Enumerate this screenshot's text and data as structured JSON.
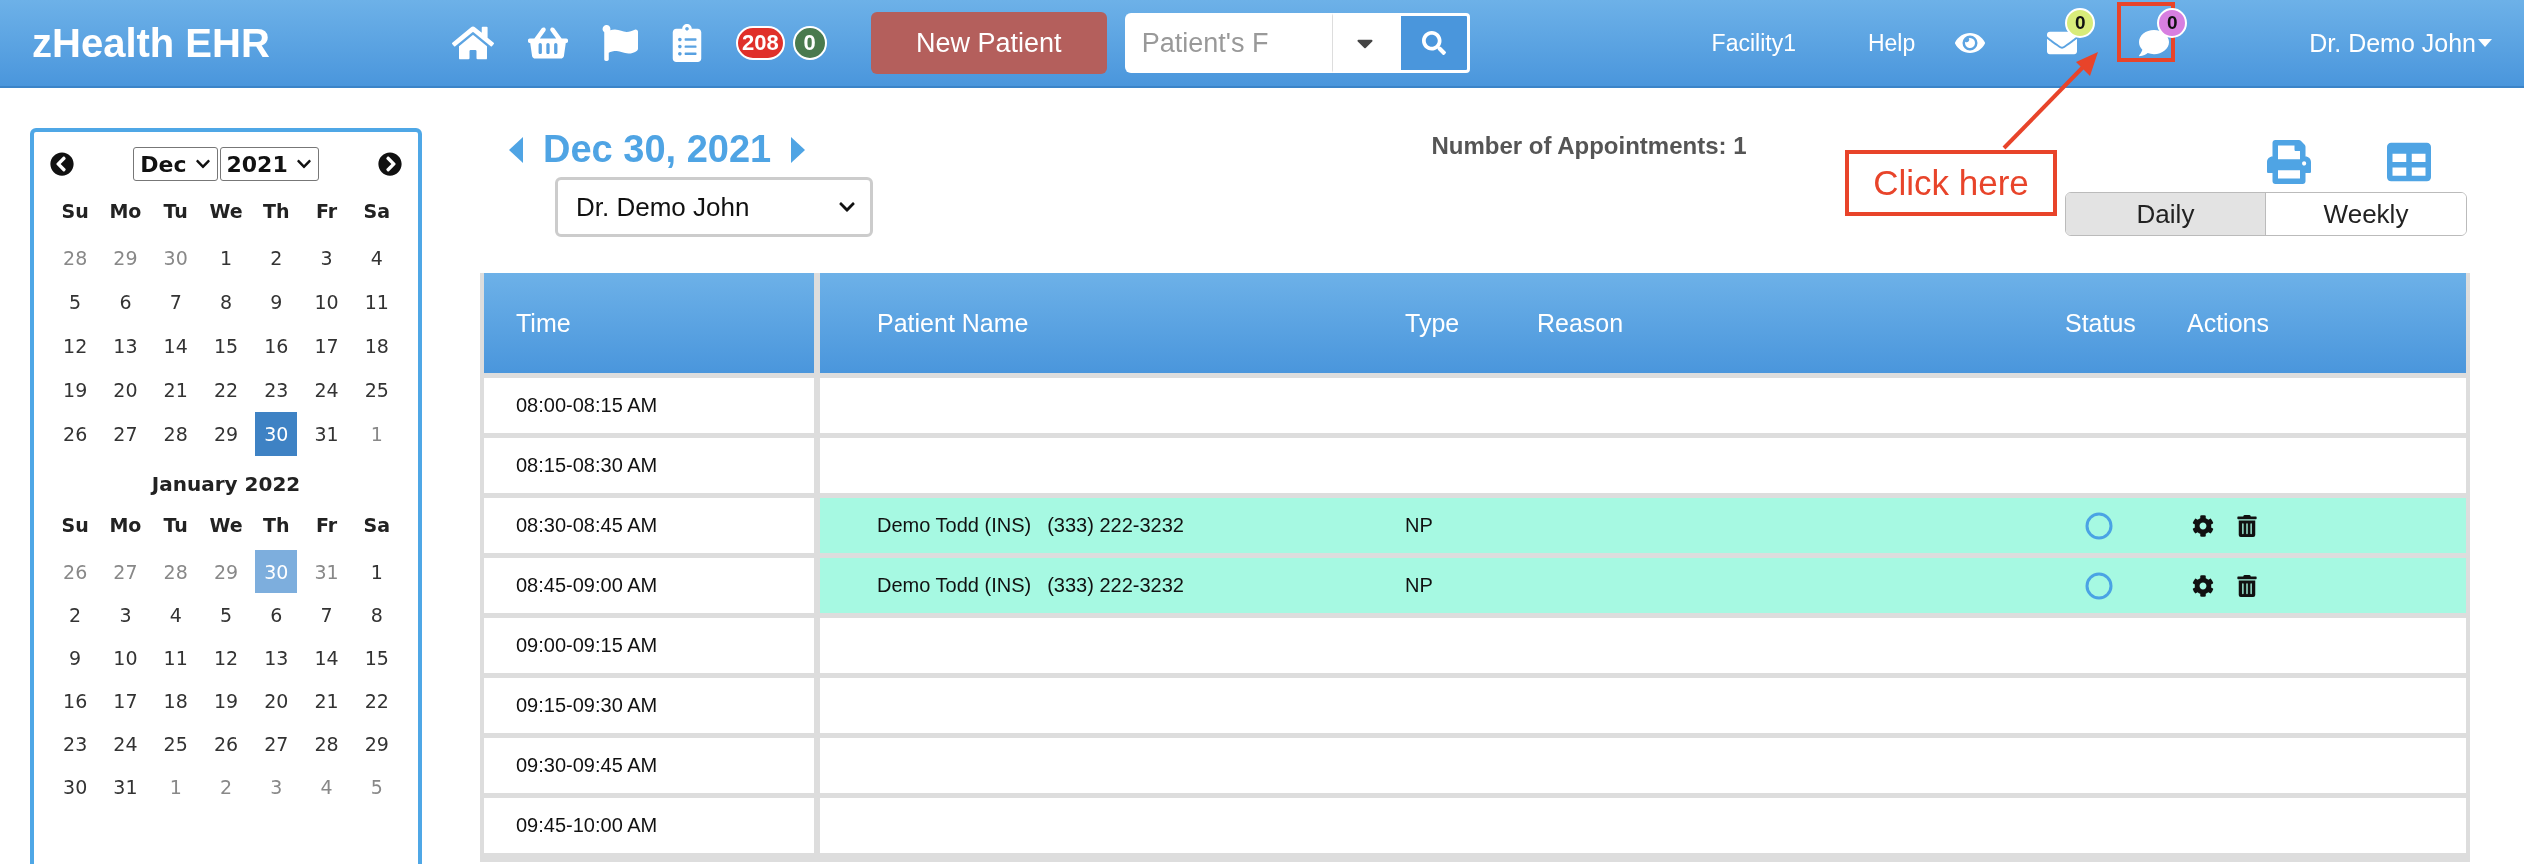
{
  "header": {
    "title": "zHealth EHR",
    "alerts": [
      {
        "count": "208",
        "color": "#e0302a"
      },
      {
        "count": "0",
        "color": "#4a7a4e"
      }
    ],
    "new_patient_button": "New Patient",
    "search": {
      "placeholder": "Patient's F"
    },
    "facility": "Facility1",
    "help": "Help",
    "messages": [
      {
        "kind": "mail",
        "count": "0",
        "color": "#d8ec7a"
      },
      {
        "kind": "chat",
        "count": "0",
        "color": "#d77fe0"
      }
    ],
    "user": "Dr. Demo John"
  },
  "annotation": {
    "callout": "Click here"
  },
  "calendar": {
    "month_select": "Dec",
    "year_select": "2021",
    "months": [
      {
        "weekdays": [
          "Su",
          "Mo",
          "Tu",
          "We",
          "Th",
          "Fr",
          "Sa"
        ],
        "weeks": [
          [
            {
              "label": "28",
              "muted": true,
              "selected": false
            },
            {
              "label": "29",
              "muted": true,
              "selected": false
            },
            {
              "label": "30",
              "muted": true,
              "selected": false
            },
            {
              "label": "1",
              "muted": false,
              "selected": false
            },
            {
              "label": "2",
              "muted": false,
              "selected": false
            },
            {
              "label": "3",
              "muted": false,
              "selected": false
            },
            {
              "label": "4",
              "muted": false,
              "selected": false
            }
          ],
          [
            {
              "label": "5",
              "muted": false,
              "selected": false
            },
            {
              "label": "6",
              "muted": false,
              "selected": false
            },
            {
              "label": "7",
              "muted": false,
              "selected": false
            },
            {
              "label": "8",
              "muted": false,
              "selected": false
            },
            {
              "label": "9",
              "muted": false,
              "selected": false
            },
            {
              "label": "10",
              "muted": false,
              "selected": false
            },
            {
              "label": "11",
              "muted": false,
              "selected": false
            }
          ],
          [
            {
              "label": "12",
              "muted": false,
              "selected": false
            },
            {
              "label": "13",
              "muted": false,
              "selected": false
            },
            {
              "label": "14",
              "muted": false,
              "selected": false
            },
            {
              "label": "15",
              "muted": false,
              "selected": false
            },
            {
              "label": "16",
              "muted": false,
              "selected": false
            },
            {
              "label": "17",
              "muted": false,
              "selected": false
            },
            {
              "label": "18",
              "muted": false,
              "selected": false
            }
          ],
          [
            {
              "label": "19",
              "muted": false,
              "selected": false
            },
            {
              "label": "20",
              "muted": false,
              "selected": false
            },
            {
              "label": "21",
              "muted": false,
              "selected": false
            },
            {
              "label": "22",
              "muted": false,
              "selected": false
            },
            {
              "label": "23",
              "muted": false,
              "selected": false
            },
            {
              "label": "24",
              "muted": false,
              "selected": false
            },
            {
              "label": "25",
              "muted": false,
              "selected": false
            }
          ],
          [
            {
              "label": "26",
              "muted": false,
              "selected": false
            },
            {
              "label": "27",
              "muted": false,
              "selected": false
            },
            {
              "label": "28",
              "muted": false,
              "selected": false
            },
            {
              "label": "29",
              "muted": false,
              "selected": false
            },
            {
              "label": "30",
              "muted": false,
              "selected": true
            },
            {
              "label": "31",
              "muted": false,
              "selected": false
            },
            {
              "label": "1",
              "muted": true,
              "selected": false
            }
          ]
        ]
      },
      {
        "title": "January 2022",
        "weekdays": [
          "Su",
          "Mo",
          "Tu",
          "We",
          "Th",
          "Fr",
          "Sa"
        ],
        "weeks": [
          [
            {
              "label": "26",
              "muted": true,
              "selected": false
            },
            {
              "label": "27",
              "muted": true,
              "selected": false
            },
            {
              "label": "28",
              "muted": true,
              "selected": false
            },
            {
              "label": "29",
              "muted": true,
              "selected": false
            },
            {
              "label": "30",
              "muted": true,
              "selected": true
            },
            {
              "label": "31",
              "muted": true,
              "selected": false
            },
            {
              "label": "1",
              "muted": false,
              "selected": false
            }
          ],
          [
            {
              "label": "2",
              "muted": false,
              "selected": false
            },
            {
              "label": "3",
              "muted": false,
              "selected": false
            },
            {
              "label": "4",
              "muted": false,
              "selected": false
            },
            {
              "label": "5",
              "muted": false,
              "selected": false
            },
            {
              "label": "6",
              "muted": false,
              "selected": false
            },
            {
              "label": "7",
              "muted": false,
              "selected": false
            },
            {
              "label": "8",
              "muted": false,
              "selected": false
            }
          ],
          [
            {
              "label": "9",
              "muted": false,
              "selected": false
            },
            {
              "label": "10",
              "muted": false,
              "selected": false
            },
            {
              "label": "11",
              "muted": false,
              "selected": false
            },
            {
              "label": "12",
              "muted": false,
              "selected": false
            },
            {
              "label": "13",
              "muted": false,
              "selected": false
            },
            {
              "label": "14",
              "muted": false,
              "selected": false
            },
            {
              "label": "15",
              "muted": false,
              "selected": false
            }
          ],
          [
            {
              "label": "16",
              "muted": false,
              "selected": false
            },
            {
              "label": "17",
              "muted": false,
              "selected": false
            },
            {
              "label": "18",
              "muted": false,
              "selected": false
            },
            {
              "label": "19",
              "muted": false,
              "selected": false
            },
            {
              "label": "20",
              "muted": false,
              "selected": false
            },
            {
              "label": "21",
              "muted": false,
              "selected": false
            },
            {
              "label": "22",
              "muted": false,
              "selected": false
            }
          ],
          [
            {
              "label": "23",
              "muted": false,
              "selected": false
            },
            {
              "label": "24",
              "muted": false,
              "selected": false
            },
            {
              "label": "25",
              "muted": false,
              "selected": false
            },
            {
              "label": "26",
              "muted": false,
              "selected": false
            },
            {
              "label": "27",
              "muted": false,
              "selected": false
            },
            {
              "label": "28",
              "muted": false,
              "selected": false
            },
            {
              "label": "29",
              "muted": false,
              "selected": false
            }
          ],
          [
            {
              "label": "30",
              "muted": false,
              "selected": false
            },
            {
              "label": "31",
              "muted": false,
              "selected": false
            },
            {
              "label": "1",
              "muted": true,
              "selected": false
            },
            {
              "label": "2",
              "muted": true,
              "selected": false
            },
            {
              "label": "3",
              "muted": true,
              "selected": false
            },
            {
              "label": "4",
              "muted": true,
              "selected": false
            },
            {
              "label": "5",
              "muted": true,
              "selected": false
            }
          ]
        ]
      }
    ]
  },
  "schedule": {
    "date": "Dec 30, 2021",
    "doctor": "Dr. Demo John",
    "appointment_count": "Number of Appointments: 1",
    "views": [
      {
        "label": "Daily",
        "selected": true
      },
      {
        "label": "Weekly",
        "selected": false
      }
    ],
    "columns": [
      "Time",
      "Patient Name",
      "Type",
      "Reason",
      "Status",
      "Actions"
    ],
    "rows": [
      {
        "time": "08:00-08:15 AM"
      },
      {
        "time": "08:15-08:30 AM"
      },
      {
        "time": "08:30-08:45 AM",
        "appointment": {
          "patient": "Demo Todd (INS)",
          "phone": "(333) 222-3232",
          "type": "NP"
        }
      },
      {
        "time": "08:45-09:00 AM",
        "appointment": {
          "patient": "Demo Todd (INS)",
          "phone": "(333) 222-3232",
          "type": "NP"
        }
      },
      {
        "time": "09:00-09:15 AM"
      },
      {
        "time": "09:15-09:30 AM"
      },
      {
        "time": "09:30-09:45 AM"
      },
      {
        "time": "09:45-10:00 AM"
      }
    ]
  }
}
